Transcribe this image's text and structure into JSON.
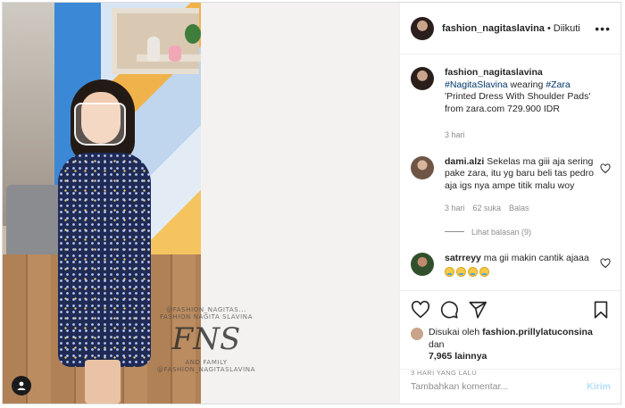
{
  "post": {
    "username": "fashion_nagitaslavina",
    "follow_status": "Diikuti",
    "separator": "•",
    "more": "•••"
  },
  "media": {
    "watermark_top": "@FASHION_NAGITAS...",
    "watermark_brand": "FASHION NAGITA SLAVINA",
    "watermark_logo": "FNS",
    "watermark_family": "AND FAMILY",
    "watermark_handle": "@FASHION_NAGITASLAVINA"
  },
  "caption": {
    "username": "fashion_nagitaslavina",
    "tag1": "#NagitaSlavina",
    "text1": " wearing ",
    "tag2": "#Zara",
    "text2": " 'Printed Dress With Shoulder Pads' from zara.com 729.900 IDR",
    "time": "3 hari"
  },
  "comments": [
    {
      "username": "dami.alzi",
      "text": " Sekelas ma giii aja sering pake zara, itu yg baru beli tas pedro aja igs nya ampe titik malu woy",
      "time": "3 hari",
      "likes": "62 suka",
      "reply": "Balas",
      "view_replies": "Lihat balasan (9)"
    },
    {
      "username": "satrreyy",
      "text": " ma gii makin cantik ajaaa"
    }
  ],
  "likes": {
    "prefix": "Disukai oleh ",
    "user": "fashion.prillylatuconsina",
    "mid": " dan",
    "count": "7,965 lainnya"
  },
  "timestamp": "3 HARI YANG LALU",
  "add_comment": {
    "placeholder": "Tambahkan komentar...",
    "send_label": "Kirim"
  },
  "colors": {
    "text": "#262626",
    "secondary": "#8e8e8e",
    "link": "#00376b",
    "send_disabled": "#b2dffc"
  }
}
